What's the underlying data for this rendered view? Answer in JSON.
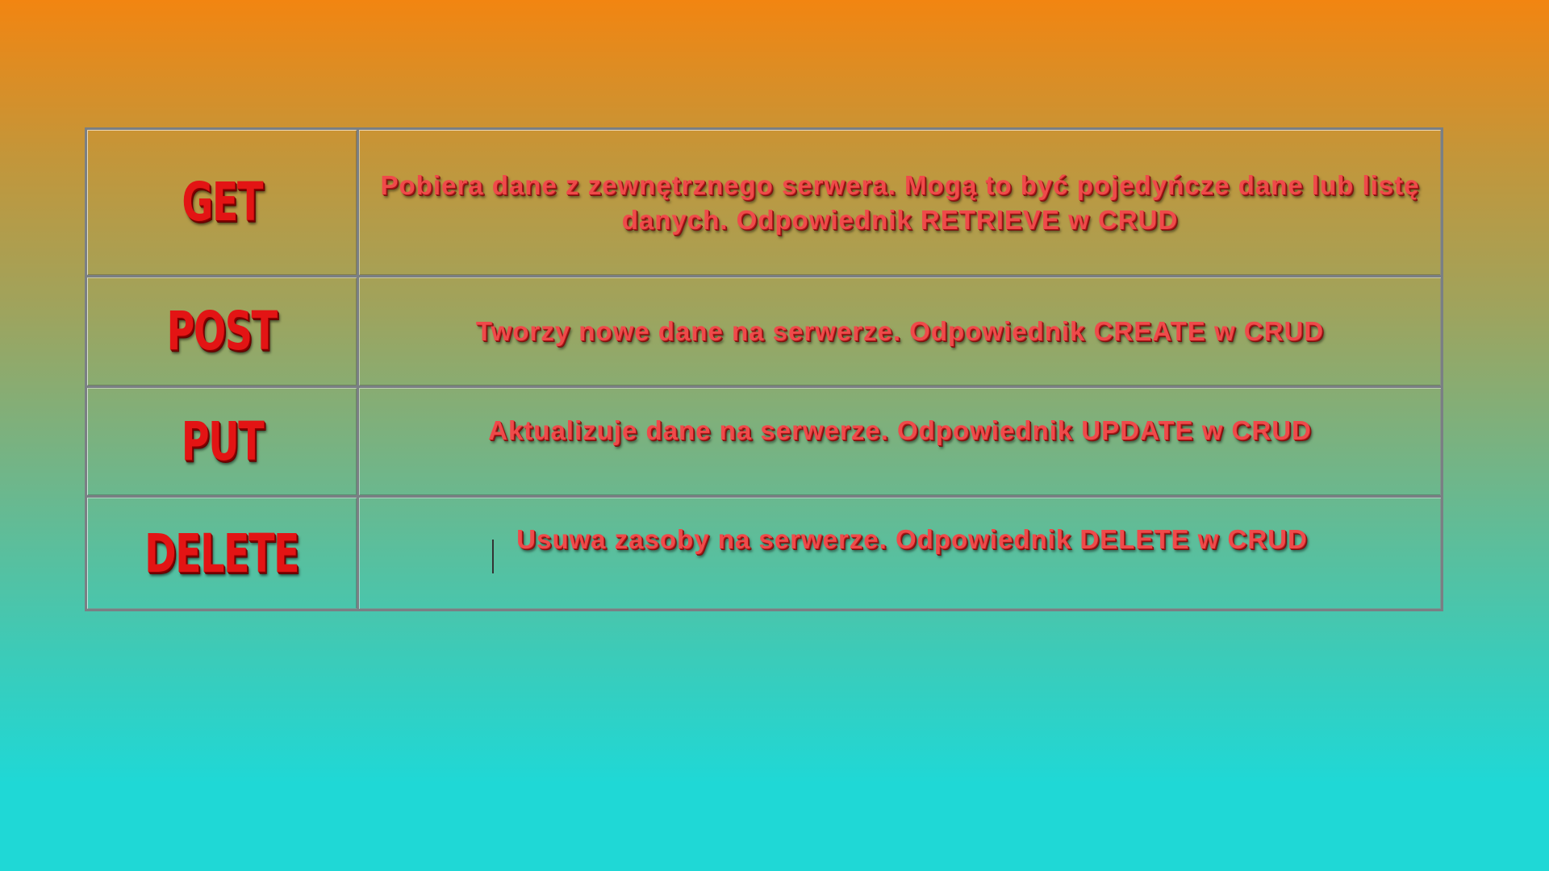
{
  "methods": [
    {
      "name": "GET",
      "description": "Pobiera dane z zewnętrznego serwera. Mogą to być pojedyńcze dane lub listę danych. Odpowiednik RETRIEVE w CRUD"
    },
    {
      "name": "POST",
      "description": "Tworzy nowe dane na serwerze. Odpowiednik CREATE w CRUD"
    },
    {
      "name": "PUT",
      "description": "Aktualizuje dane na serwerze. Odpowiednik UPDATE w CRUD"
    },
    {
      "name": "DELETE",
      "description": "Usuwa zasoby na serwerze. Odpowiednik DELETE w CRUD"
    }
  ],
  "colors": {
    "gradient_top": "#f28511",
    "gradient_bottom": "#1fd8d6",
    "method_text": "#e31414",
    "description_text": "#ef4a4a",
    "table_border": "#7a7f84"
  }
}
